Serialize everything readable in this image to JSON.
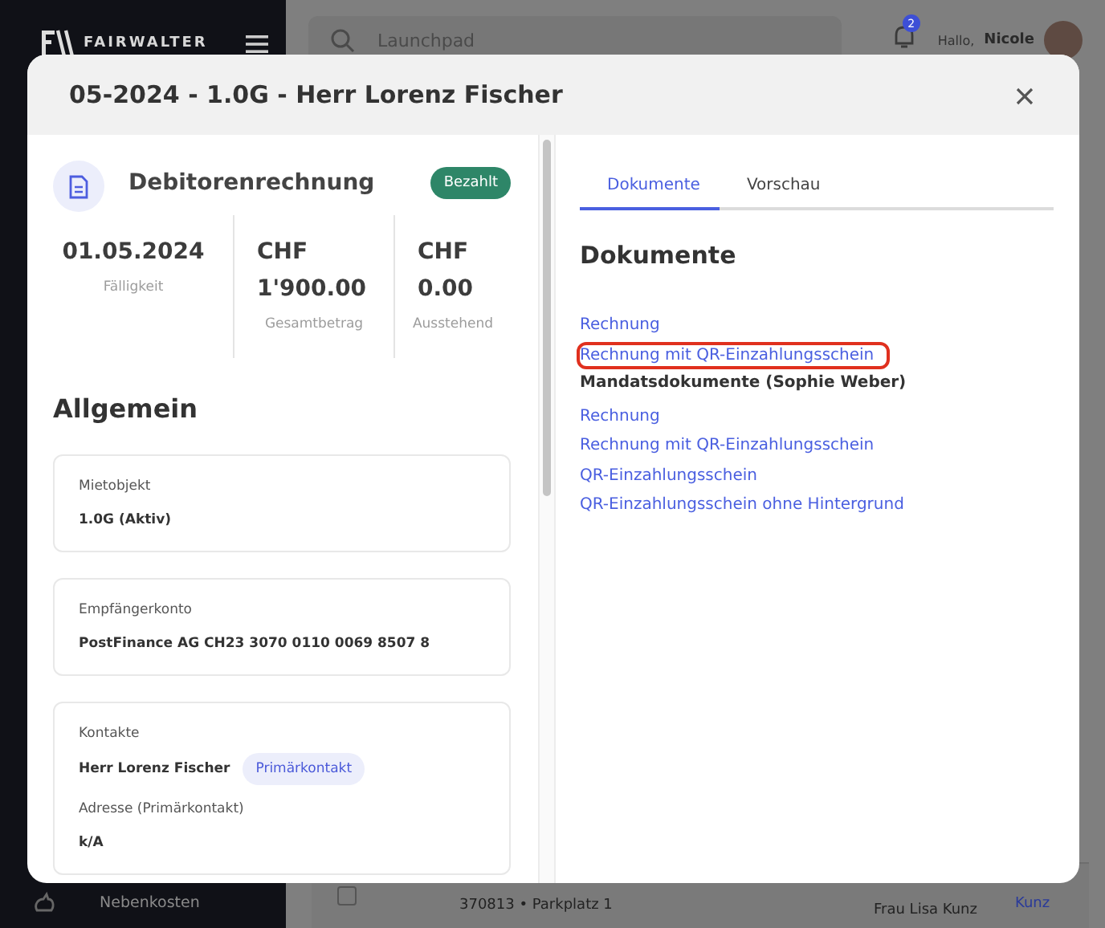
{
  "sidebar": {
    "logo": "FAIRWALTER",
    "items": [
      {
        "label": "Nebenkosten",
        "selected": false
      }
    ]
  },
  "topbar": {
    "search": {
      "placeholder": "Launchpad"
    },
    "notifications": "2",
    "greeting": "Hallo,",
    "user": "Nicole"
  },
  "background_row": {
    "checked": false,
    "reference": "370813 • Parkplatz 1",
    "tenant": "Frau Lisa Kunz",
    "link": "Kunz"
  },
  "modal": {
    "title": "05-2024 - 1.0G - Herr Lorenz Fischer",
    "document_type": "Debitorenrechnung",
    "status": "Bezahlt",
    "stats": [
      {
        "value": "01.05.2024",
        "label": "Fälligkeit"
      },
      {
        "value": "CHF 1'900.00",
        "label": "Gesamtbetrag"
      },
      {
        "value": "CHF 0.00",
        "label": "Ausstehend"
      }
    ],
    "section_title": "Allgemein",
    "cards": [
      {
        "kind": "field",
        "label": "Mietobjekt",
        "value": "1.0G  (Aktiv)"
      },
      {
        "kind": "field",
        "label": "Empfängerkonto",
        "value": "PostFinance AG CH23 3070 0110 0069 8507 8"
      },
      {
        "kind": "contacts",
        "label": "Kontakte",
        "name": "Herr Lorenz Fischer",
        "badge": "Primärkontakt",
        "address_label": "Adresse (Primärkontakt)",
        "address": "k/A"
      }
    ],
    "tabs": [
      {
        "label": "Dokumente",
        "selected": true
      },
      {
        "label": "Vorschau",
        "selected": false
      }
    ],
    "documents_heading": "Dokumente",
    "documents": [
      {
        "kind": "link",
        "label": "Rechnung",
        "highlighted": false
      },
      {
        "kind": "link",
        "label": "Rechnung mit QR-Einzahlungsschein",
        "highlighted": true
      },
      {
        "kind": "heading",
        "label": "Mandatsdokumente (Sophie Weber)",
        "highlighted": false
      },
      {
        "kind": "link",
        "label": "Rechnung",
        "highlighted": false
      },
      {
        "kind": "link",
        "label": "Rechnung mit QR-Einzahlungsschein",
        "highlighted": false
      },
      {
        "kind": "link",
        "label": "QR-Einzahlungsschein",
        "highlighted": false
      },
      {
        "kind": "link",
        "label": "QR-Einzahlungsschein ohne Hintergrund",
        "highlighted": false
      }
    ]
  }
}
